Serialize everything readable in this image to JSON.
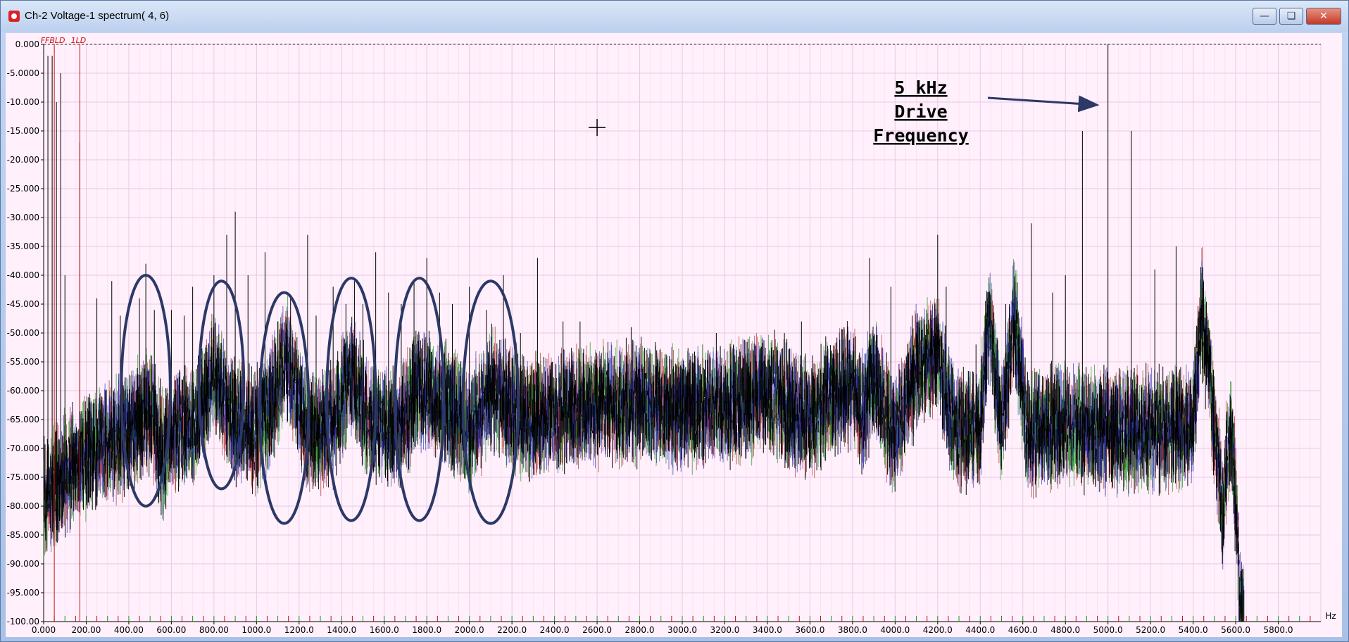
{
  "window": {
    "title": "Ch-2 Voltage-1 spectrum( 4, 6)",
    "icons": {
      "app": "app-logo-icon",
      "minimize": "minimize-icon",
      "maximize": "maximize-icon",
      "close": "close-icon"
    }
  },
  "chart_data": {
    "type": "line",
    "xlabel": "Hz",
    "ylabel": "",
    "xlim": [
      0,
      6000
    ],
    "ylim": [
      -100,
      0
    ],
    "x_ticks": [
      "0.000",
      "200.00",
      "400.00",
      "600.00",
      "800.00",
      "1000.0",
      "1200.0",
      "1400.0",
      "1600.0",
      "1800.0",
      "2000.0",
      "2200.0",
      "2400.0",
      "2600.0",
      "2800.0",
      "3000.0",
      "3200.0",
      "3400.0",
      "3600.0",
      "3800.0",
      "4000.0",
      "4200.0",
      "4400.0",
      "4600.0",
      "4800.0",
      "5000.0",
      "5200.0",
      "5400.0",
      "5600.0",
      "5800.0"
    ],
    "y_ticks": [
      "0.000",
      "-5.0000",
      "-10.000",
      "-15.000",
      "-20.000",
      "-25.000",
      "-30.000",
      "-35.000",
      "-40.000",
      "-45.000",
      "-50.000",
      "-55.000",
      "-60.000",
      "-65.000",
      "-70.000",
      "-75.000",
      "-80.000",
      "-85.000",
      "-90.000",
      "-95.000",
      "-100.00"
    ],
    "grid": true,
    "reference_level": 0,
    "series_colors": [
      "#000000",
      "#1a1ab0",
      "#0a8a0a",
      "#a01010"
    ],
    "noise_floor": [
      [
        0,
        -78
      ],
      [
        100,
        -73
      ],
      [
        200,
        -70
      ],
      [
        300,
        -68
      ],
      [
        400,
        -66
      ],
      [
        500,
        -62
      ],
      [
        560,
        -70
      ],
      [
        640,
        -65
      ],
      [
        700,
        -66
      ],
      [
        800,
        -56
      ],
      [
        880,
        -64
      ],
      [
        1000,
        -66
      ],
      [
        1080,
        -60
      ],
      [
        1140,
        -53
      ],
      [
        1240,
        -66
      ],
      [
        1360,
        -65
      ],
      [
        1440,
        -55
      ],
      [
        1520,
        -64
      ],
      [
        1640,
        -66
      ],
      [
        1720,
        -62
      ],
      [
        1760,
        -58
      ],
      [
        1900,
        -62
      ],
      [
        2000,
        -66
      ],
      [
        2100,
        -59
      ],
      [
        2200,
        -62
      ],
      [
        2300,
        -64
      ],
      [
        2500,
        -62
      ],
      [
        2800,
        -61
      ],
      [
        3000,
        -62
      ],
      [
        3200,
        -62
      ],
      [
        3400,
        -59
      ],
      [
        3500,
        -62
      ],
      [
        3600,
        -64
      ],
      [
        3700,
        -60
      ],
      [
        3800,
        -58
      ],
      [
        3840,
        -63
      ],
      [
        3880,
        -60
      ],
      [
        3900,
        -57
      ],
      [
        4000,
        -67
      ],
      [
        4100,
        -55
      ],
      [
        4200,
        -52
      ],
      [
        4280,
        -66
      ],
      [
        4400,
        -65
      ],
      [
        4440,
        -47
      ],
      [
        4500,
        -65
      ],
      [
        4560,
        -46
      ],
      [
        4620,
        -66
      ],
      [
        4800,
        -65
      ],
      [
        5000,
        -66
      ],
      [
        5200,
        -66
      ],
      [
        5400,
        -65
      ],
      [
        5440,
        -45
      ],
      [
        5480,
        -58
      ],
      [
        5520,
        -72
      ],
      [
        5540,
        -80
      ],
      [
        5560,
        -70
      ],
      [
        5580,
        -66
      ],
      [
        5600,
        -78
      ],
      [
        5620,
        -94
      ],
      [
        5640,
        -100
      ]
    ],
    "spurs": [
      [
        20,
        -2
      ],
      [
        40,
        -2
      ],
      [
        60,
        -10
      ],
      [
        80,
        -5
      ],
      [
        100,
        -40
      ],
      [
        170,
        -17
      ],
      [
        250,
        -44
      ],
      [
        320,
        -41
      ],
      [
        360,
        -47
      ],
      [
        450,
        -44
      ],
      [
        480,
        -38
      ],
      [
        520,
        -46
      ],
      [
        600,
        -46
      ],
      [
        660,
        -47
      ],
      [
        700,
        -42
      ],
      [
        800,
        -40
      ],
      [
        860,
        -33
      ],
      [
        900,
        -29
      ],
      [
        960,
        -40
      ],
      [
        1040,
        -36
      ],
      [
        1100,
        -48
      ],
      [
        1160,
        -44
      ],
      [
        1240,
        -33
      ],
      [
        1280,
        -47
      ],
      [
        1360,
        -42
      ],
      [
        1420,
        -45
      ],
      [
        1460,
        -41
      ],
      [
        1500,
        -45
      ],
      [
        1560,
        -36
      ],
      [
        1620,
        -43
      ],
      [
        1680,
        -45
      ],
      [
        1740,
        -41
      ],
      [
        1800,
        -37
      ],
      [
        1860,
        -43
      ],
      [
        1920,
        -45
      ],
      [
        2000,
        -42
      ],
      [
        2080,
        -46
      ],
      [
        2160,
        -40
      ],
      [
        2240,
        -50
      ],
      [
        2320,
        -37
      ],
      [
        2440,
        -48
      ],
      [
        2520,
        -48
      ],
      [
        2600,
        -56
      ],
      [
        2680,
        -54
      ],
      [
        2760,
        -49
      ],
      [
        2880,
        -53
      ],
      [
        3040,
        -54
      ],
      [
        3160,
        -50
      ],
      [
        3240,
        -52
      ],
      [
        3320,
        -55
      ],
      [
        3480,
        -50
      ],
      [
        3560,
        -48
      ],
      [
        3680,
        -54
      ],
      [
        3760,
        -49
      ],
      [
        3880,
        -37
      ],
      [
        3980,
        -42
      ],
      [
        4080,
        -47
      ],
      [
        4200,
        -33
      ],
      [
        4240,
        -42
      ],
      [
        4380,
        -52
      ],
      [
        4520,
        -45
      ],
      [
        4640,
        -31
      ],
      [
        4740,
        -43
      ],
      [
        4800,
        -40
      ],
      [
        4880,
        -15
      ],
      [
        5000,
        0
      ],
      [
        5110,
        -15
      ],
      [
        5220,
        -39
      ],
      [
        5320,
        -35
      ],
      [
        5460,
        -51
      ]
    ],
    "annotations": [
      {
        "text_lines": [
          "5 kHz",
          "Drive",
          "Frequency"
        ],
        "arrow_to": [
          4950,
          -10.5
        ]
      }
    ],
    "ellipses": [
      {
        "cx": 480,
        "cy": -60,
        "rx": 115,
        "ry": 20
      },
      {
        "cx": 835,
        "cy": -59,
        "rx": 105,
        "ry": 18
      },
      {
        "cx": 1130,
        "cy": -63,
        "rx": 115,
        "ry": 20
      },
      {
        "cx": 1445,
        "cy": -61.5,
        "rx": 115,
        "ry": 21
      },
      {
        "cx": 1765,
        "cy": -61.5,
        "rx": 115,
        "ry": 21
      },
      {
        "cx": 2100,
        "cy": -62,
        "rx": 130,
        "ry": 21
      }
    ],
    "markers": [
      {
        "label": "FFBLD",
        "x": 50
      },
      {
        "label": "1LD",
        "x": 170
      }
    ],
    "cursor": {
      "x": 2600,
      "y": -14.4
    }
  }
}
